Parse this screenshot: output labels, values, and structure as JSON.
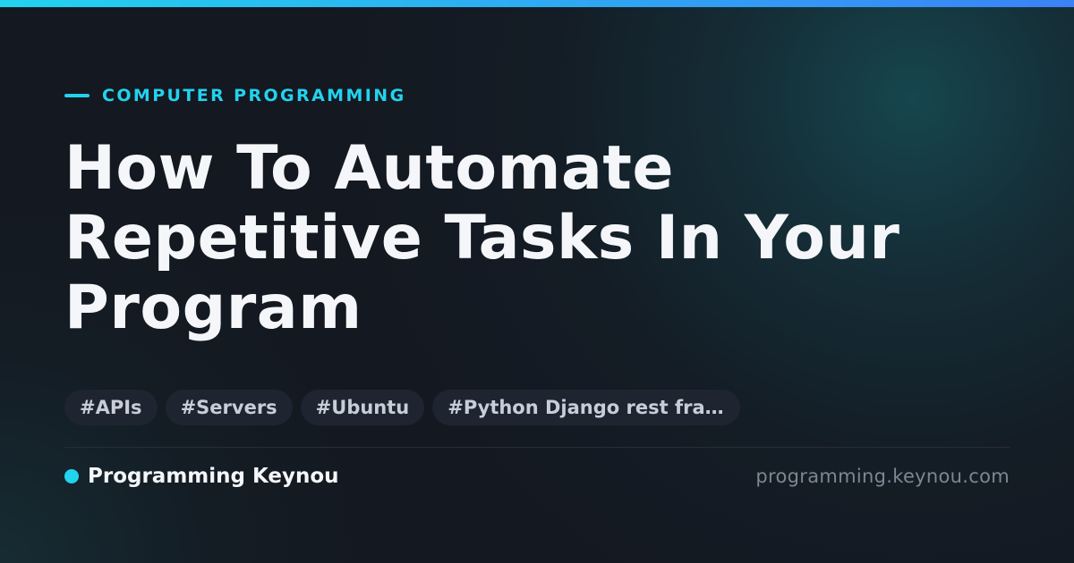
{
  "colors": {
    "accent": "#22d3ee",
    "accent_end": "#3b82f6",
    "background": "#141820",
    "title_text": "#f4f6f9",
    "tag_background": "#1e2530",
    "tag_text": "#c8ced8",
    "muted_text": "#7e8692"
  },
  "category": {
    "label": "COMPUTER PROGRAMMING"
  },
  "article": {
    "title": "How To Automate Repetitive Tasks In Your Program"
  },
  "tags": [
    "#APIs",
    "#Servers",
    "#Ubuntu",
    "#Python Django rest fram…"
  ],
  "footer": {
    "author": "Programming Keynou",
    "site": "programming.keynou.com"
  }
}
